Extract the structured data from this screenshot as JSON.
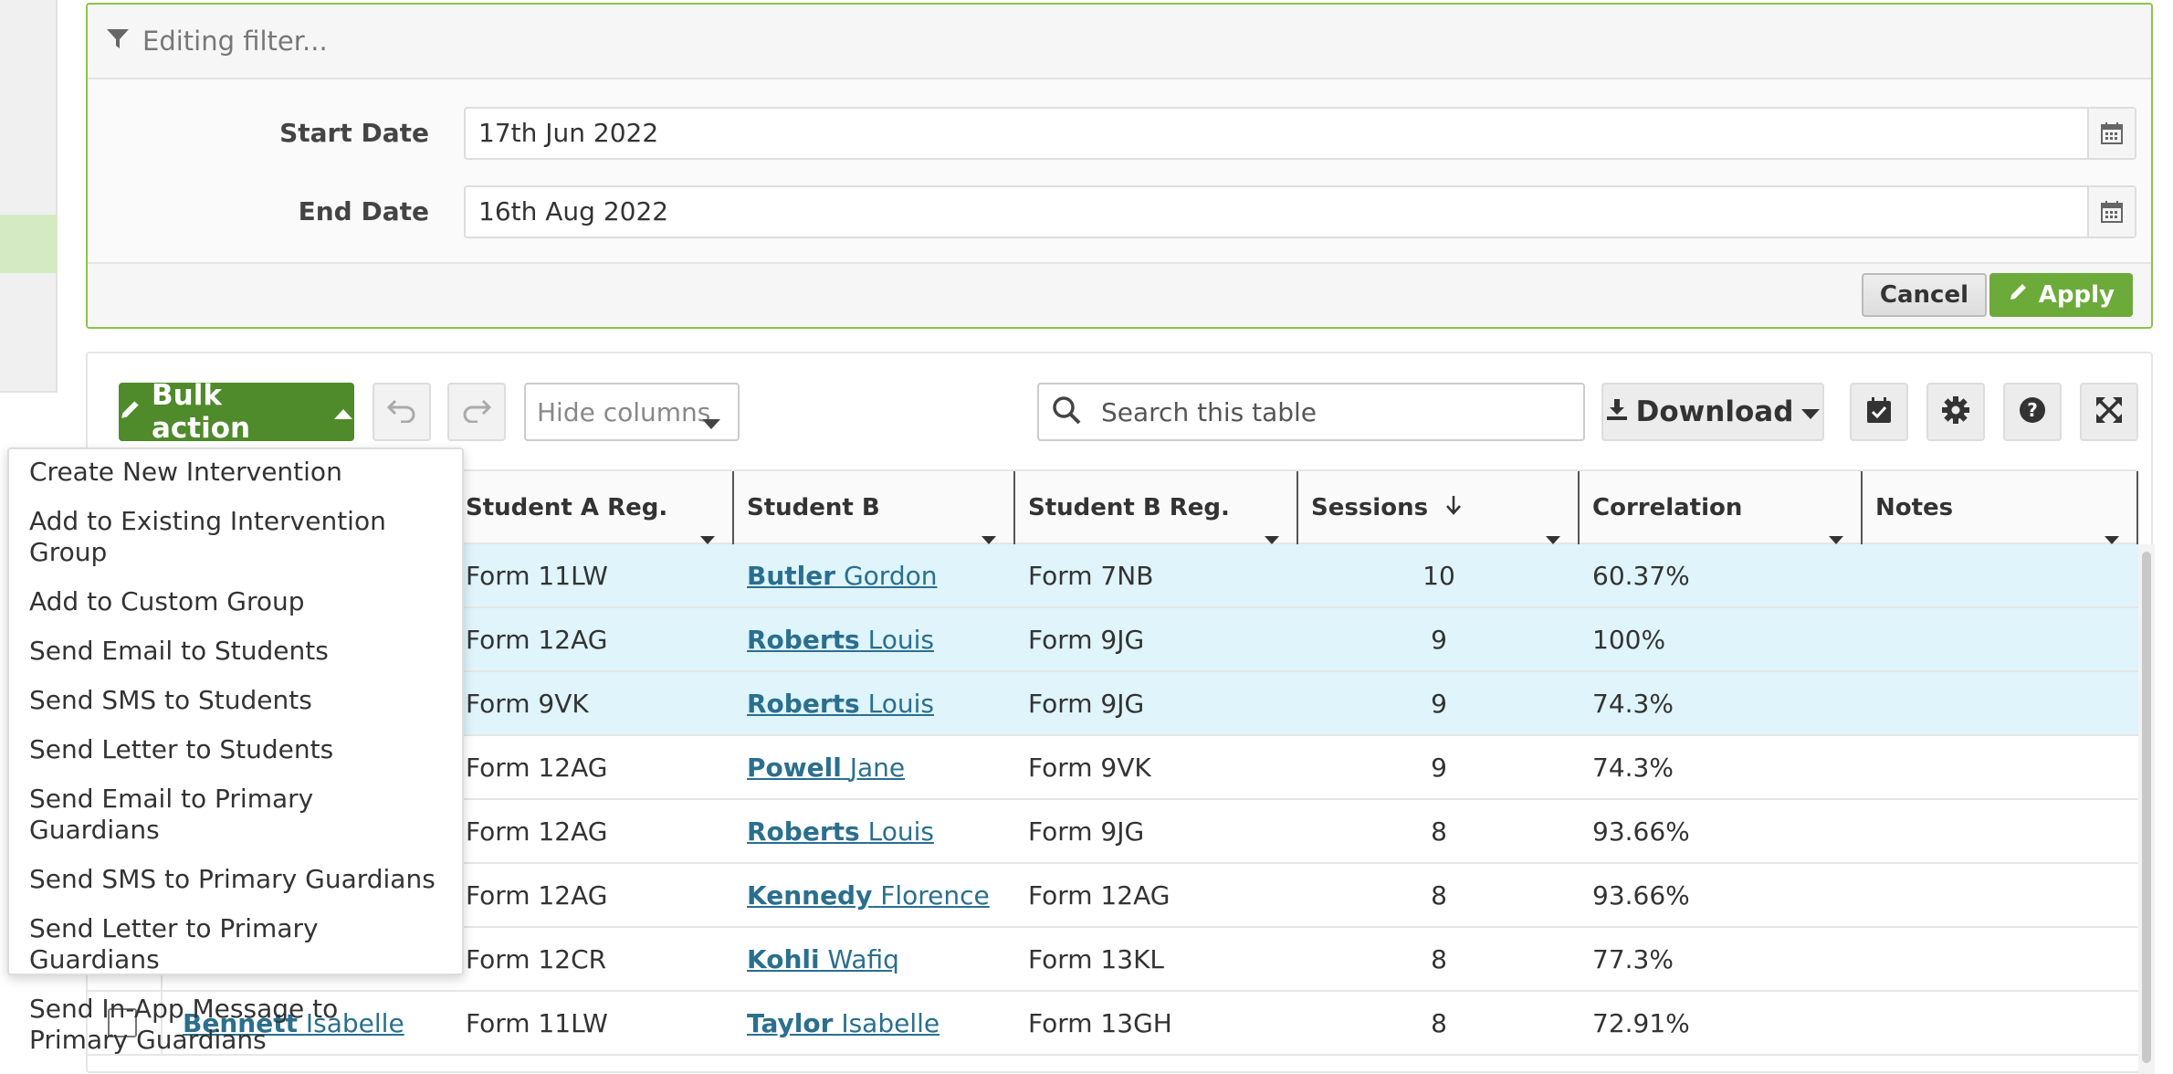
{
  "filter": {
    "title": "Editing filter...",
    "start_label": "Start Date",
    "start_value": "17th Jun 2022",
    "end_label": "End Date",
    "end_value": "16th Aug 2022",
    "cancel_label": "Cancel",
    "apply_label": "Apply"
  },
  "toolbar": {
    "bulk_label": "Bulk action",
    "hide_columns_label": "Hide columns",
    "search_placeholder": "Search this table",
    "download_label": "Download"
  },
  "bulk_menu": [
    "Create New Intervention",
    "Add to Existing Intervention Group",
    "Add to Custom Group",
    "Send Email to Students",
    "Send SMS to Students",
    "Send Letter to Students",
    "Send Email to Primary Guardians",
    "Send SMS to Primary Guardians",
    "Send Letter to Primary Guardians",
    "Send In-App Message to Primary Guardians"
  ],
  "table": {
    "headers": {
      "student_a_form": "Student A Reg. Form",
      "student_b": "Student B",
      "student_b_form": "Student B Reg. Form",
      "sessions": "Sessions",
      "correlation": "Correlation",
      "notes": "Notes"
    },
    "rows": [
      {
        "a_surname": "",
        "a_first": "",
        "a_form": "Form 11LW",
        "b_surname": "Butler",
        "b_first": "Gordon",
        "b_form": "Form 7NB",
        "sessions": "10",
        "correlation": "60.37%"
      },
      {
        "a_surname": "",
        "a_first": "",
        "a_form": "Form 12AG",
        "b_surname": "Roberts",
        "b_first": "Louis",
        "b_form": "Form 9JG",
        "sessions": "9",
        "correlation": "100%"
      },
      {
        "a_surname": "",
        "a_first": "",
        "a_form": "Form 9VK",
        "b_surname": "Roberts",
        "b_first": "Louis",
        "b_form": "Form 9JG",
        "sessions": "9",
        "correlation": "74.3%"
      },
      {
        "a_surname": "",
        "a_first": "",
        "a_form": "Form 12AG",
        "b_surname": "Powell",
        "b_first": "Jane",
        "b_form": "Form 9VK",
        "sessions": "9",
        "correlation": "74.3%"
      },
      {
        "a_surname": "",
        "a_first": "",
        "a_form": "Form 12AG",
        "b_surname": "Roberts",
        "b_first": "Louis",
        "b_form": "Form 9JG",
        "sessions": "8",
        "correlation": "93.66%"
      },
      {
        "a_surname": "",
        "a_first": "",
        "a_form": "Form 12AG",
        "b_surname": "Kennedy",
        "b_first": "Florence",
        "b_form": "Form 12AG",
        "sessions": "8",
        "correlation": "93.66%"
      },
      {
        "a_surname": "",
        "a_first": "",
        "a_form": "Form 12CR",
        "b_surname": "Kohli",
        "b_first": "Wafiq",
        "b_form": "Form 13KL",
        "sessions": "8",
        "correlation": "77.3%"
      },
      {
        "a_surname": "Bennett",
        "a_first": "Isabelle",
        "a_form": "Form 11LW",
        "b_surname": "Taylor",
        "b_first": "Isabelle",
        "b_form": "Form 13GH",
        "sessions": "8",
        "correlation": "72.91%"
      }
    ]
  },
  "colors": {
    "accent_green": "#4f8a2b",
    "apply_green": "#6cab3a",
    "filter_border": "#8bc34a",
    "selected_row": "#dff4fb",
    "link": "#2a6f8f"
  }
}
